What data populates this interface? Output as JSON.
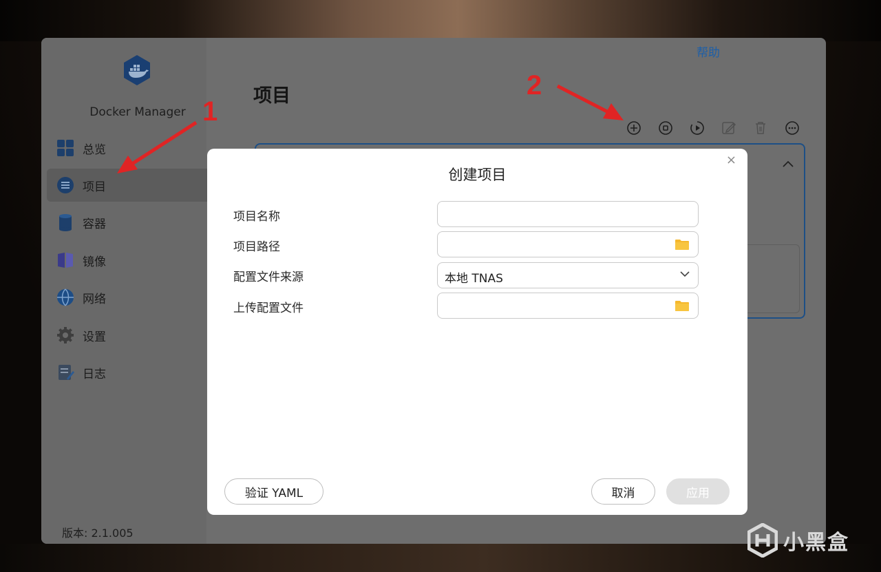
{
  "app": {
    "name": "Docker Manager",
    "help_label": "帮助",
    "version_label": "版本: 2.1.005"
  },
  "sidebar": {
    "items": [
      {
        "label": "总览",
        "icon": "grid-icon"
      },
      {
        "label": "项目",
        "icon": "list-icon",
        "active": true
      },
      {
        "label": "容器",
        "icon": "cylinder-icon"
      },
      {
        "label": "镜像",
        "icon": "book-icon"
      },
      {
        "label": "网络",
        "icon": "globe-icon"
      },
      {
        "label": "设置",
        "icon": "gear-icon"
      },
      {
        "label": "日志",
        "icon": "log-icon"
      }
    ]
  },
  "main": {
    "title": "项目",
    "toolbar": [
      "add-icon",
      "stop-icon",
      "restart-icon",
      "edit-icon",
      "delete-icon",
      "more-icon"
    ]
  },
  "annotations": {
    "marker_1": "1",
    "marker_2": "2",
    "color": "#e02424"
  },
  "dialog": {
    "title": "创建项目",
    "close_glyph": "×",
    "fields": {
      "name_label": "项目名称",
      "name_value": "",
      "path_label": "项目路径",
      "path_value": "",
      "source_label": "配置文件来源",
      "source_value": "本地 TNAS",
      "upload_label": "上传配置文件",
      "upload_value": ""
    },
    "buttons": {
      "validate": "验证 YAML",
      "cancel": "取消",
      "apply": "应用"
    }
  },
  "watermark": {
    "text": "小黑盒"
  },
  "colors": {
    "accent": "#1d5fa8",
    "folder": "#f5b82e"
  }
}
